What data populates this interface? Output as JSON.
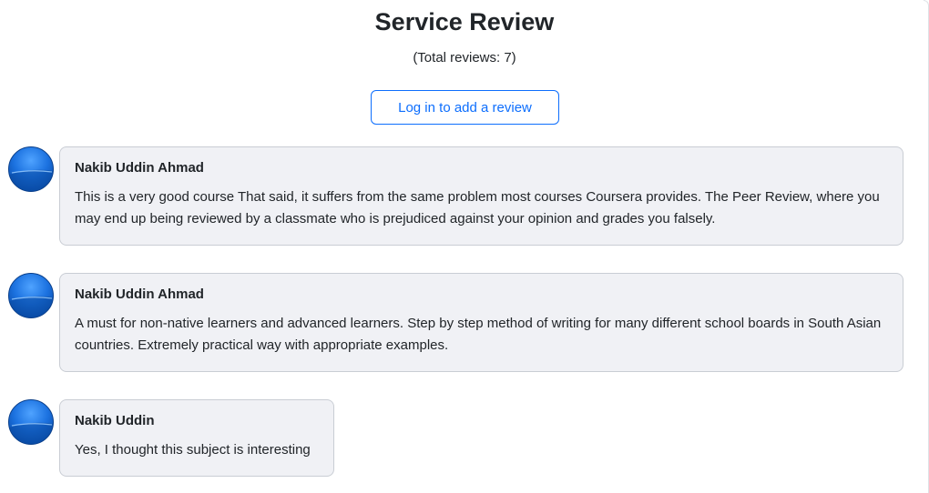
{
  "header": {
    "title": "Service Review",
    "total_label": "(Total reviews: 7)"
  },
  "actions": {
    "login_label": "Log in to add a review"
  },
  "reviews": [
    {
      "name": "Nakib Uddin Ahmad",
      "text": "This is a very good course That said, it suffers from the same problem most courses Coursera provides. The Peer Review, where you may end up being reviewed by a classmate who is prejudiced against your opinion and grades you falsely.",
      "avatar_icon": "user-avatar-icon"
    },
    {
      "name": "Nakib Uddin Ahmad",
      "text": "A must for non-native learners and advanced learners. Step by step method of writing for many different school boards in South Asian countries. Extremely practical way with appropriate examples.",
      "avatar_icon": "user-avatar-icon"
    },
    {
      "name": "Nakib Uddin",
      "text": "Yes, I thought this subject is interesting",
      "avatar_icon": "user-avatar-icon"
    }
  ],
  "colors": {
    "accent": "#0d6efd",
    "bubble_bg": "#f0f1f5",
    "bubble_border": "#c9cdd4"
  }
}
